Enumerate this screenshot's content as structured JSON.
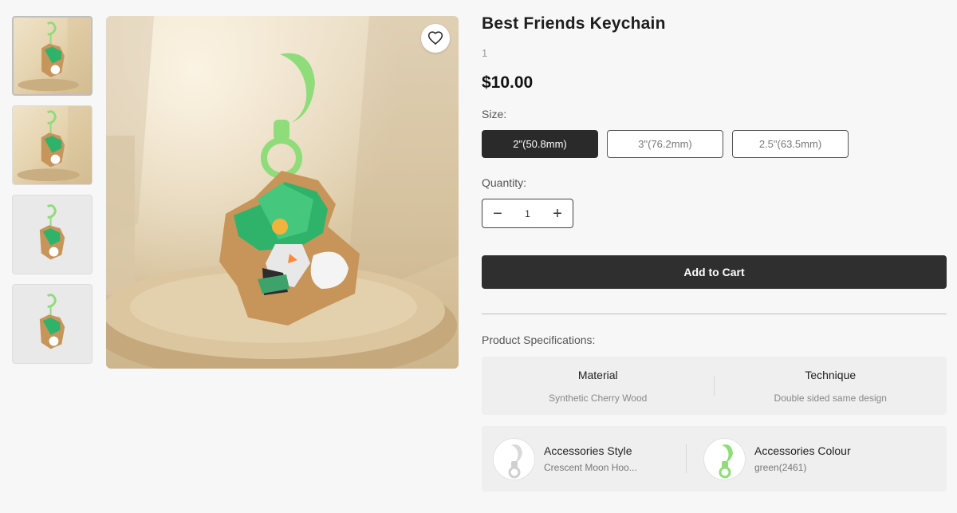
{
  "product": {
    "title": "Best Friends Keychain",
    "subtitle": "1",
    "price": "$10.00"
  },
  "size": {
    "label": "Size:",
    "options": [
      "2\"(50.8mm)",
      "3\"(76.2mm)",
      "2.5\"(63.5mm)"
    ],
    "selected": "2\"(50.8mm)"
  },
  "quantity": {
    "label": "Quantity:",
    "value": "1",
    "minus": "−",
    "plus": "+"
  },
  "cart": {
    "add_label": "Add to Cart"
  },
  "specs": {
    "label": "Product Specifications:",
    "items": [
      {
        "name": "Material",
        "value": "Synthetic Cherry Wood"
      },
      {
        "name": "Technique",
        "value": "Double sided same design"
      }
    ]
  },
  "accessories": [
    {
      "name": "Accessories Style",
      "value": "Crescent Moon Hoo...",
      "icon": "moon-hook-icon"
    },
    {
      "name": "Accessories Colour",
      "value": "green(2461)",
      "icon": "green-hook-icon"
    }
  ],
  "icons": {
    "favorite": "heart-icon"
  },
  "colors": {
    "accent_dark": "#2f2f2f",
    "hook_green": "#8fdc7a",
    "character_green": "#2fb36a"
  }
}
